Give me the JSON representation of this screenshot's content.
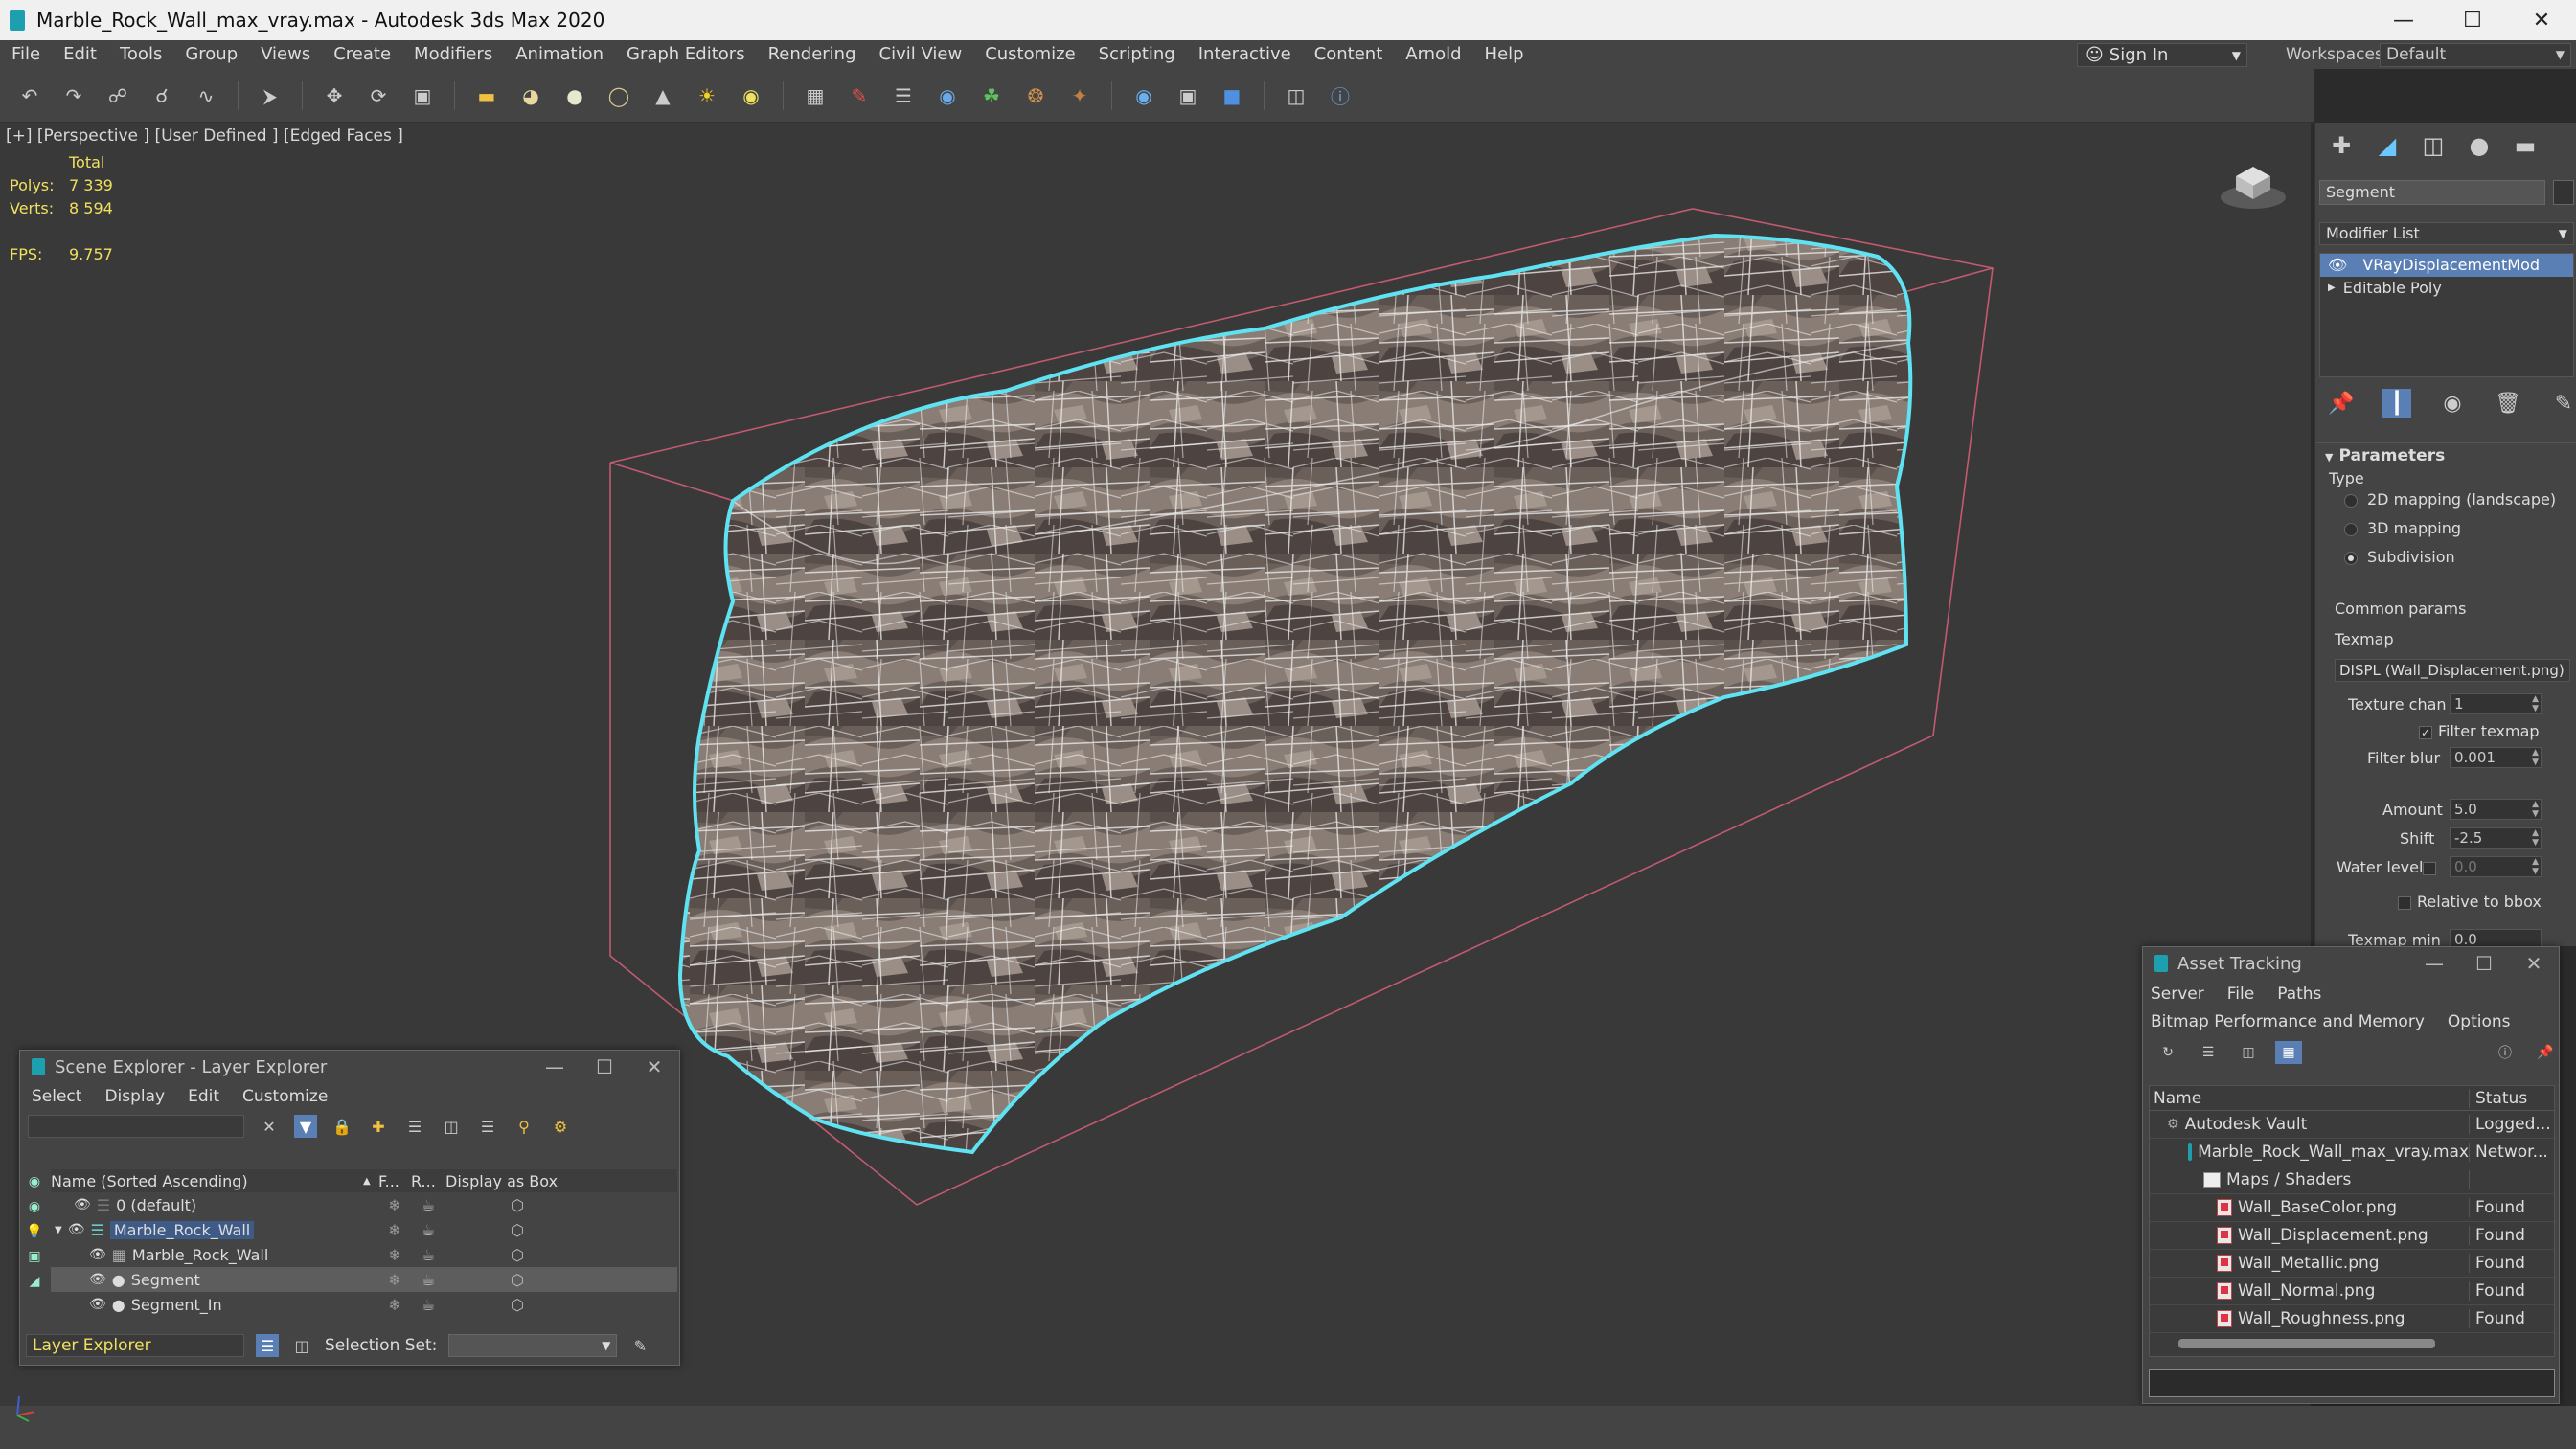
{
  "window": {
    "title": "Marble_Rock_Wall_max_vray.max - Autodesk 3ds Max 2020",
    "minimize": "—",
    "maximize": "☐",
    "close": "✕"
  },
  "menu": [
    "File",
    "Edit",
    "Tools",
    "Group",
    "Views",
    "Create",
    "Modifiers",
    "Animation",
    "Graph Editors",
    "Rendering",
    "Civil View",
    "Customize",
    "Scripting",
    "Interactive",
    "Content",
    "Arnold",
    "Help"
  ],
  "account": {
    "sign_in": "Sign In",
    "workspaces_label": "Workspaces:",
    "workspace_value": "Default"
  },
  "viewport": {
    "label": "[+] [Perspective ] [User Defined ] [Edged Faces ]",
    "stats": {
      "total_label": "Total",
      "polys_label": "Polys:",
      "polys_value": "7 339",
      "verts_label": "Verts:",
      "verts_value": "8 594",
      "fps_label": "FPS:",
      "fps_value": "9.757"
    }
  },
  "command_panel": {
    "object_name": "Segment",
    "modifier_list": "Modifier List",
    "stack": [
      "VRayDisplacementMod",
      "Editable Poly"
    ],
    "params_title": "Parameters",
    "type_label": "Type",
    "type_options": [
      "2D mapping (landscape)",
      "3D mapping",
      "Subdivision"
    ],
    "common_params": "Common params",
    "texmap_label": "Texmap",
    "texmap_value": "DISPL (Wall_Displacement.png)",
    "texture_chan_label": "Texture chan",
    "texture_chan_value": "1",
    "filter_texmap_label": "Filter texmap",
    "filter_blur_label": "Filter blur",
    "filter_blur_value": "0.001",
    "amount_label": "Amount",
    "amount_value": "5.0",
    "shift_label": "Shift",
    "shift_value": "-2.5",
    "water_level_label": "Water level",
    "water_level_value": "0.0",
    "relative_bbox_label": "Relative to bbox",
    "texmap_min_label": "Texmap min",
    "texmap_min_value": "0.0"
  },
  "scene_explorer": {
    "title": "Scene Explorer - Layer Explorer",
    "menus": [
      "Select",
      "Display",
      "Edit",
      "Customize"
    ],
    "col_name": "Name (Sorted Ascending)",
    "col_f": "F...",
    "col_r": "R...",
    "col_box": "Display as Box",
    "rows": [
      {
        "name": "0 (default)",
        "indent": 1
      },
      {
        "name": "Marble_Rock_Wall",
        "indent": 0
      },
      {
        "name": "Marble_Rock_Wall",
        "indent": 2
      },
      {
        "name": "Segment",
        "indent": 2
      },
      {
        "name": "Segment_In",
        "indent": 2
      }
    ],
    "explorer_type": "Layer Explorer",
    "selection_set_label": "Selection Set:"
  },
  "asset_tracking": {
    "title": "Asset Tracking",
    "menus_row1": [
      "Server",
      "File",
      "Paths"
    ],
    "menus_row2": [
      "Bitmap Performance and Memory",
      "Options"
    ],
    "col_name": "Name",
    "col_status": "Status",
    "rows": [
      {
        "name": "Autodesk Vault",
        "status": "Logged...",
        "indent": 0,
        "icon": "vault"
      },
      {
        "name": "Marble_Rock_Wall_max_vray.max",
        "status": "Networ...",
        "indent": 1,
        "icon": "max"
      },
      {
        "name": "Maps / Shaders",
        "status": "",
        "indent": 2,
        "icon": "folder"
      },
      {
        "name": "Wall_BaseColor.png",
        "status": "Found",
        "indent": 3,
        "icon": "file"
      },
      {
        "name": "Wall_Displacement.png",
        "status": "Found",
        "indent": 3,
        "icon": "file"
      },
      {
        "name": "Wall_Metallic.png",
        "status": "Found",
        "indent": 3,
        "icon": "file"
      },
      {
        "name": "Wall_Normal.png",
        "status": "Found",
        "indent": 3,
        "icon": "file"
      },
      {
        "name": "Wall_Roughness.png",
        "status": "Found",
        "indent": 3,
        "icon": "file"
      }
    ]
  }
}
